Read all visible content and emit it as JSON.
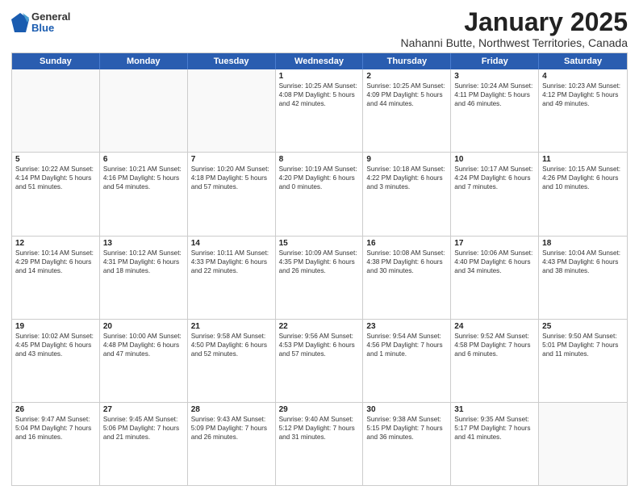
{
  "header": {
    "logo": {
      "general": "General",
      "blue": "Blue"
    },
    "title": "January 2025",
    "subtitle": "Nahanni Butte, Northwest Territories, Canada"
  },
  "days_of_week": [
    "Sunday",
    "Monday",
    "Tuesday",
    "Wednesday",
    "Thursday",
    "Friday",
    "Saturday"
  ],
  "weeks": [
    [
      {
        "day": "",
        "info": ""
      },
      {
        "day": "",
        "info": ""
      },
      {
        "day": "",
        "info": ""
      },
      {
        "day": "1",
        "info": "Sunrise: 10:25 AM\nSunset: 4:08 PM\nDaylight: 5 hours and 42 minutes."
      },
      {
        "day": "2",
        "info": "Sunrise: 10:25 AM\nSunset: 4:09 PM\nDaylight: 5 hours and 44 minutes."
      },
      {
        "day": "3",
        "info": "Sunrise: 10:24 AM\nSunset: 4:11 PM\nDaylight: 5 hours and 46 minutes."
      },
      {
        "day": "4",
        "info": "Sunrise: 10:23 AM\nSunset: 4:12 PM\nDaylight: 5 hours and 49 minutes."
      }
    ],
    [
      {
        "day": "5",
        "info": "Sunrise: 10:22 AM\nSunset: 4:14 PM\nDaylight: 5 hours and 51 minutes."
      },
      {
        "day": "6",
        "info": "Sunrise: 10:21 AM\nSunset: 4:16 PM\nDaylight: 5 hours and 54 minutes."
      },
      {
        "day": "7",
        "info": "Sunrise: 10:20 AM\nSunset: 4:18 PM\nDaylight: 5 hours and 57 minutes."
      },
      {
        "day": "8",
        "info": "Sunrise: 10:19 AM\nSunset: 4:20 PM\nDaylight: 6 hours and 0 minutes."
      },
      {
        "day": "9",
        "info": "Sunrise: 10:18 AM\nSunset: 4:22 PM\nDaylight: 6 hours and 3 minutes."
      },
      {
        "day": "10",
        "info": "Sunrise: 10:17 AM\nSunset: 4:24 PM\nDaylight: 6 hours and 7 minutes."
      },
      {
        "day": "11",
        "info": "Sunrise: 10:15 AM\nSunset: 4:26 PM\nDaylight: 6 hours and 10 minutes."
      }
    ],
    [
      {
        "day": "12",
        "info": "Sunrise: 10:14 AM\nSunset: 4:29 PM\nDaylight: 6 hours and 14 minutes."
      },
      {
        "day": "13",
        "info": "Sunrise: 10:12 AM\nSunset: 4:31 PM\nDaylight: 6 hours and 18 minutes."
      },
      {
        "day": "14",
        "info": "Sunrise: 10:11 AM\nSunset: 4:33 PM\nDaylight: 6 hours and 22 minutes."
      },
      {
        "day": "15",
        "info": "Sunrise: 10:09 AM\nSunset: 4:35 PM\nDaylight: 6 hours and 26 minutes."
      },
      {
        "day": "16",
        "info": "Sunrise: 10:08 AM\nSunset: 4:38 PM\nDaylight: 6 hours and 30 minutes."
      },
      {
        "day": "17",
        "info": "Sunrise: 10:06 AM\nSunset: 4:40 PM\nDaylight: 6 hours and 34 minutes."
      },
      {
        "day": "18",
        "info": "Sunrise: 10:04 AM\nSunset: 4:43 PM\nDaylight: 6 hours and 38 minutes."
      }
    ],
    [
      {
        "day": "19",
        "info": "Sunrise: 10:02 AM\nSunset: 4:45 PM\nDaylight: 6 hours and 43 minutes."
      },
      {
        "day": "20",
        "info": "Sunrise: 10:00 AM\nSunset: 4:48 PM\nDaylight: 6 hours and 47 minutes."
      },
      {
        "day": "21",
        "info": "Sunrise: 9:58 AM\nSunset: 4:50 PM\nDaylight: 6 hours and 52 minutes."
      },
      {
        "day": "22",
        "info": "Sunrise: 9:56 AM\nSunset: 4:53 PM\nDaylight: 6 hours and 57 minutes."
      },
      {
        "day": "23",
        "info": "Sunrise: 9:54 AM\nSunset: 4:56 PM\nDaylight: 7 hours and 1 minute."
      },
      {
        "day": "24",
        "info": "Sunrise: 9:52 AM\nSunset: 4:58 PM\nDaylight: 7 hours and 6 minutes."
      },
      {
        "day": "25",
        "info": "Sunrise: 9:50 AM\nSunset: 5:01 PM\nDaylight: 7 hours and 11 minutes."
      }
    ],
    [
      {
        "day": "26",
        "info": "Sunrise: 9:47 AM\nSunset: 5:04 PM\nDaylight: 7 hours and 16 minutes."
      },
      {
        "day": "27",
        "info": "Sunrise: 9:45 AM\nSunset: 5:06 PM\nDaylight: 7 hours and 21 minutes."
      },
      {
        "day": "28",
        "info": "Sunrise: 9:43 AM\nSunset: 5:09 PM\nDaylight: 7 hours and 26 minutes."
      },
      {
        "day": "29",
        "info": "Sunrise: 9:40 AM\nSunset: 5:12 PM\nDaylight: 7 hours and 31 minutes."
      },
      {
        "day": "30",
        "info": "Sunrise: 9:38 AM\nSunset: 5:15 PM\nDaylight: 7 hours and 36 minutes."
      },
      {
        "day": "31",
        "info": "Sunrise: 9:35 AM\nSunset: 5:17 PM\nDaylight: 7 hours and 41 minutes."
      },
      {
        "day": "",
        "info": ""
      }
    ]
  ]
}
